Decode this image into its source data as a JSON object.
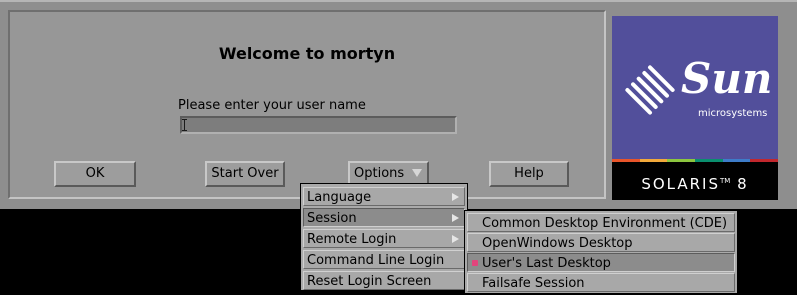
{
  "dialog": {
    "title": "Welcome to mortyn",
    "prompt": "Please enter your user name",
    "username_value": ""
  },
  "buttons": {
    "ok": "OK",
    "start_over": "Start Over",
    "options": "Options",
    "help": "Help"
  },
  "logo": {
    "brand": "Sun",
    "subtitle": "microsystems",
    "product": "SOLARIS",
    "trademark": "TM",
    "version": "8",
    "stripe_colors": [
      "#e8552a",
      "#f2a93b",
      "#8cc63f",
      "#0a8f6e",
      "#3d7cc9",
      "#c2272d"
    ]
  },
  "options_menu": {
    "items": [
      {
        "label": "Language",
        "has_submenu": true
      },
      {
        "label": "Session",
        "has_submenu": true,
        "active": true
      },
      {
        "label": "Remote Login",
        "has_submenu": true
      },
      {
        "label": "Command Line Login",
        "has_submenu": false
      },
      {
        "label": "Reset Login Screen",
        "has_submenu": false
      }
    ]
  },
  "session_menu": {
    "items": [
      {
        "label": "Common Desktop Environment (CDE)"
      },
      {
        "label": "OpenWindows Desktop"
      },
      {
        "label": "User's Last Desktop",
        "selected": true
      },
      {
        "label": "Failsafe Session"
      }
    ]
  },
  "colors": {
    "dialog_bg": "#8e8e8e",
    "logo_bg": "#524f9b",
    "radio_selected": "#e2447c"
  }
}
